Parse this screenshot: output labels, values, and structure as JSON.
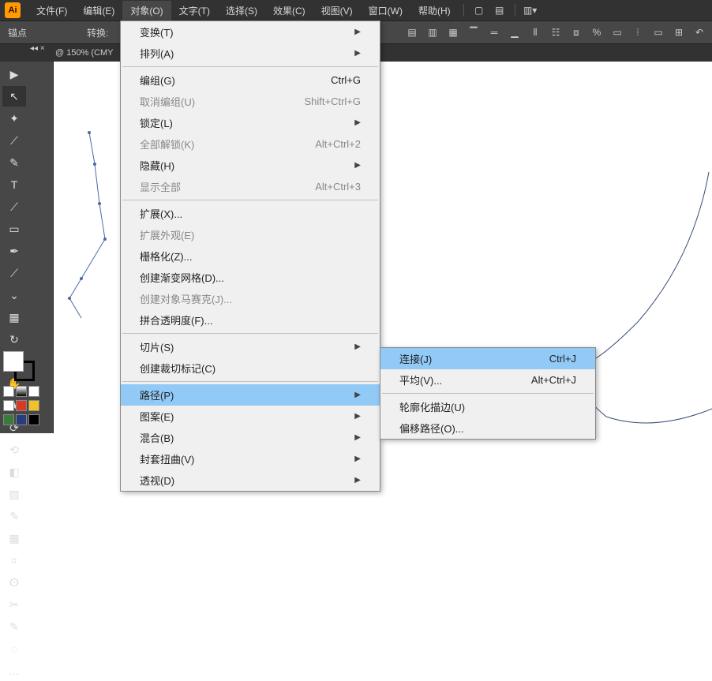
{
  "app": {
    "logo": "Ai"
  },
  "menubar": {
    "items": [
      "文件(F)",
      "编辑(E)",
      "对象(O)",
      "文字(T)",
      "选择(S)",
      "效果(C)",
      "视图(V)",
      "窗口(W)",
      "帮助(H)"
    ],
    "active_index": 2
  },
  "options_bar": {
    "label_anchor": "锚点",
    "label_convert": "转换:"
  },
  "tab": {
    "zoom_info": "@ 150% (CMY"
  },
  "tools": [
    "▶",
    "↖",
    "✦",
    "⟋",
    "✎",
    "T",
    "⟋",
    "▭",
    "✒",
    "⟋",
    "⌄",
    "▦",
    "↻",
    "▦",
    "✋",
    "★",
    "⟳",
    "⟲",
    "◧",
    "▨",
    "✎",
    "▦",
    "⌗",
    "ⵙ",
    "✂",
    "✎",
    "◌",
    "…"
  ],
  "swatch_modes": [
    "#ffffff",
    "#d63b2a",
    "#f2c127",
    "#3a7b3a",
    "#2a3d7b",
    "#000000"
  ],
  "dropdown": {
    "items": [
      {
        "label": "变换(T)",
        "shortcut": "",
        "arrow": true,
        "disabled": false
      },
      {
        "label": "排列(A)",
        "shortcut": "",
        "arrow": true,
        "disabled": false
      },
      {
        "sep": true
      },
      {
        "label": "编组(G)",
        "shortcut": "Ctrl+G",
        "arrow": false,
        "disabled": false
      },
      {
        "label": "取消编组(U)",
        "shortcut": "Shift+Ctrl+G",
        "arrow": false,
        "disabled": true
      },
      {
        "label": "锁定(L)",
        "shortcut": "",
        "arrow": true,
        "disabled": false
      },
      {
        "label": "全部解锁(K)",
        "shortcut": "Alt+Ctrl+2",
        "arrow": false,
        "disabled": true
      },
      {
        "label": "隐藏(H)",
        "shortcut": "",
        "arrow": true,
        "disabled": false
      },
      {
        "label": "显示全部",
        "shortcut": "Alt+Ctrl+3",
        "arrow": false,
        "disabled": true
      },
      {
        "sep": true
      },
      {
        "label": "扩展(X)...",
        "shortcut": "",
        "arrow": false,
        "disabled": false
      },
      {
        "label": "扩展外观(E)",
        "shortcut": "",
        "arrow": false,
        "disabled": true
      },
      {
        "label": "栅格化(Z)...",
        "shortcut": "",
        "arrow": false,
        "disabled": false
      },
      {
        "label": "创建渐变网格(D)...",
        "shortcut": "",
        "arrow": false,
        "disabled": false
      },
      {
        "label": "创建对象马赛克(J)...",
        "shortcut": "",
        "arrow": false,
        "disabled": true
      },
      {
        "label": "拼合透明度(F)...",
        "shortcut": "",
        "arrow": false,
        "disabled": false
      },
      {
        "sep": true
      },
      {
        "label": "切片(S)",
        "shortcut": "",
        "arrow": true,
        "disabled": false
      },
      {
        "label": "创建裁切标记(C)",
        "shortcut": "",
        "arrow": false,
        "disabled": false
      },
      {
        "sep": true
      },
      {
        "label": "路径(P)",
        "shortcut": "",
        "arrow": true,
        "disabled": false,
        "highlight": true
      },
      {
        "label": "图案(E)",
        "shortcut": "",
        "arrow": true,
        "disabled": false
      },
      {
        "label": "混合(B)",
        "shortcut": "",
        "arrow": true,
        "disabled": false
      },
      {
        "label": "封套扭曲(V)",
        "shortcut": "",
        "arrow": true,
        "disabled": false
      },
      {
        "label": "透视(D)",
        "shortcut": "",
        "arrow": true,
        "disabled": false
      }
    ]
  },
  "submenu": {
    "items": [
      {
        "label": "连接(J)",
        "shortcut": "Ctrl+J",
        "highlight": true
      },
      {
        "label": "平均(V)...",
        "shortcut": "Alt+Ctrl+J"
      },
      {
        "sep": true
      },
      {
        "label": "轮廓化描边(U)",
        "shortcut": ""
      },
      {
        "label": "偏移路径(O)...",
        "shortcut": ""
      }
    ]
  }
}
